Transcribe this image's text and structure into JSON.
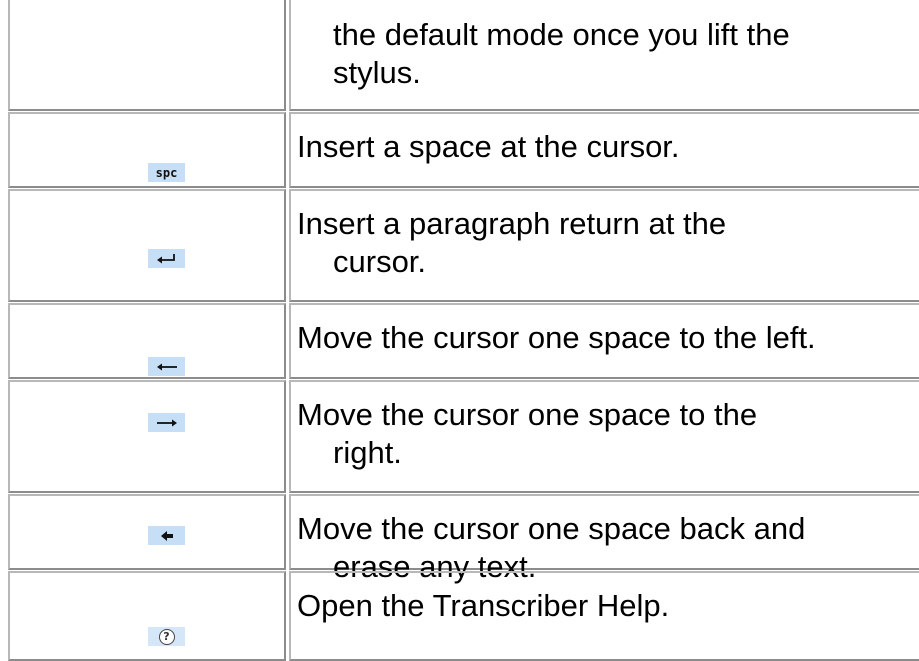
{
  "rows": [
    {
      "icon": "",
      "line1": "the default mode once you lift the",
      "line2": "stylus."
    },
    {
      "icon": "space-key-icon",
      "icon_text": "spc",
      "line1": "Insert a space at the cursor.",
      "line2": ""
    },
    {
      "icon": "return-key-icon",
      "line1": "Insert a paragraph return at the",
      "line2": "cursor."
    },
    {
      "icon": "left-arrow-icon",
      "line1": "Move the cursor one space to the left.",
      "line2": ""
    },
    {
      "icon": "right-arrow-icon",
      "line1": "Move the cursor one space to the",
      "line2": "right."
    },
    {
      "icon": "backspace-icon",
      "line1": "Move the cursor one space back and",
      "line2": "erase any text."
    },
    {
      "icon": "help-icon",
      "icon_text": "?",
      "line1": "Open the Transcriber Help.",
      "line2": ""
    }
  ],
  "colors": {
    "icon_background": "#c6dff6",
    "border_light": "#b8b8b8",
    "border_dark": "#8c8c8c"
  }
}
